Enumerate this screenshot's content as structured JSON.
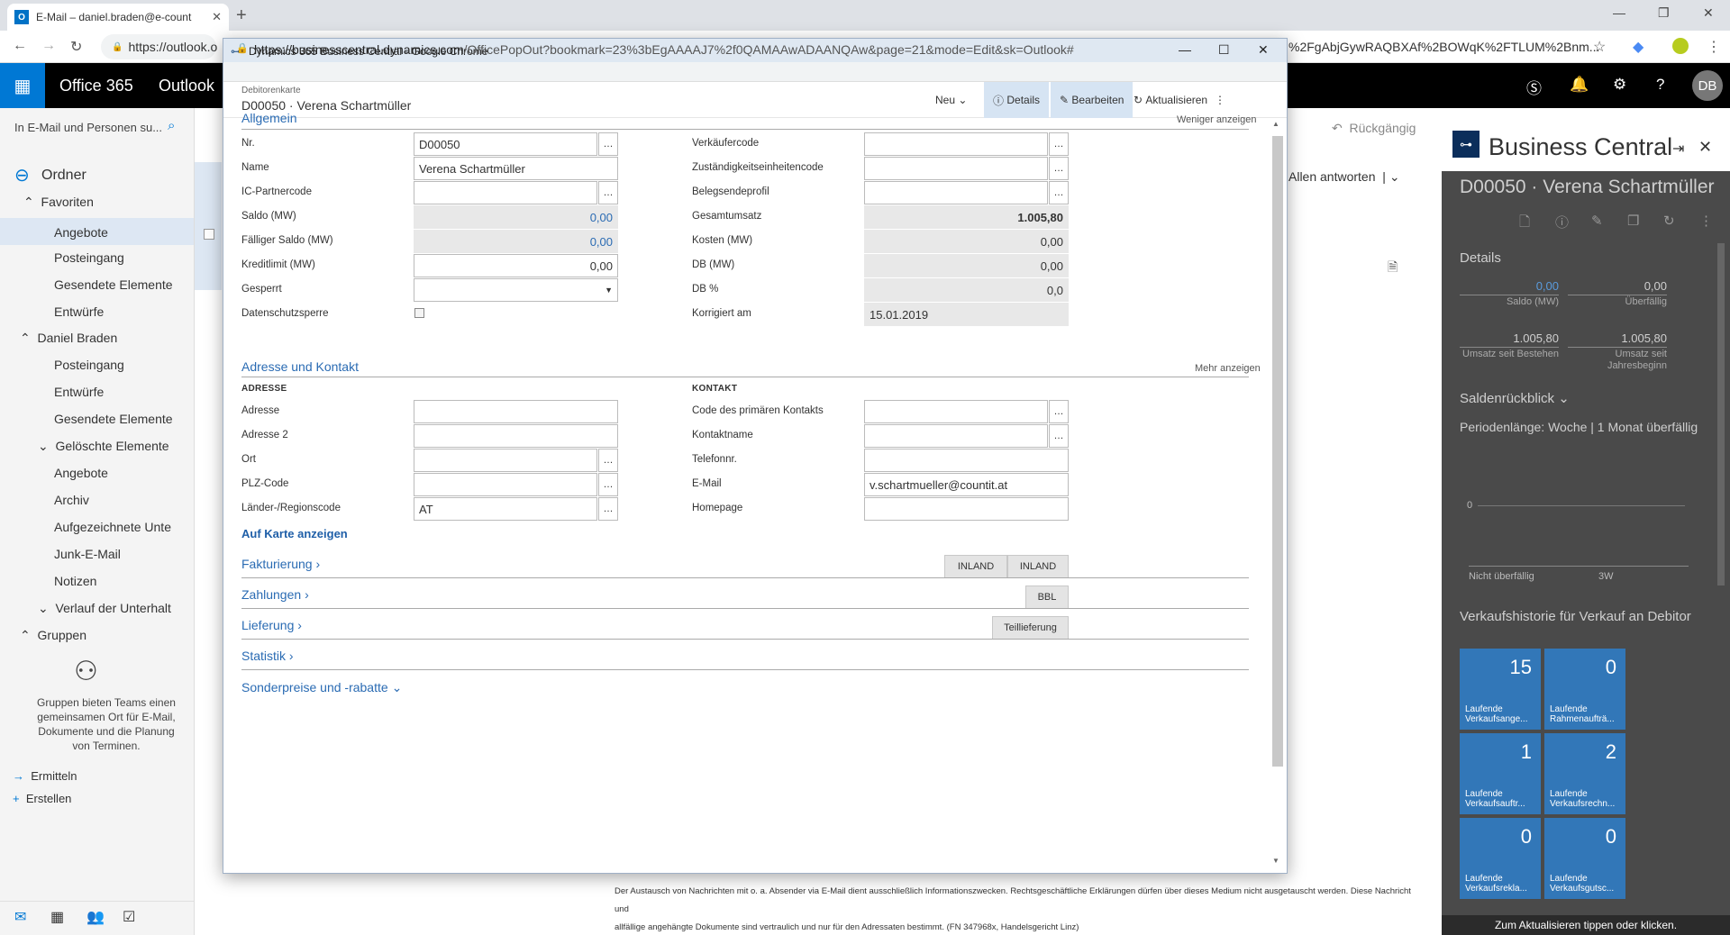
{
  "browser": {
    "tab_title": "E-Mail – daniel.braden@e-count",
    "omnibox": "https://outlook.o",
    "omnibox_tail": "%2FgAbjGywRAQBXAf%2BOWqK%2FTLUM%2Bnm..."
  },
  "suite": {
    "brand": "Office 365",
    "app": "Outlook",
    "avatar": "DB"
  },
  "outlook": {
    "search_placeholder": "In E-Mail und Personen su...",
    "folders_label": "Ordner",
    "favorites": "Favoriten",
    "fav_items": [
      "Angebote",
      "Posteingang",
      "Gesendete Elemente",
      "Entwürfe"
    ],
    "account": "Daniel Braden",
    "acc_items": [
      "Posteingang",
      "Entwürfe",
      "Gesendete Elemente",
      "Gelöschte Elemente",
      "Angebote",
      "Archiv",
      "Aufgezeichnete Unte",
      "Junk-E-Mail",
      "Notizen",
      "Verlauf der Unterhalt"
    ],
    "groups": "Gruppen",
    "groups_desc": "Gruppen bieten Teams einen gemeinsamen Ort für E-Mail, Dokumente und die Planung von Terminen.",
    "discover": "Ermitteln",
    "create": "Erstellen",
    "reply_all": "Allen antworten",
    "undo": "Rückgängig",
    "disclaimer1": "Der Austausch von Nachrichten mit o. a. Absender via E-Mail dient ausschließlich Informationszwecken. Rechtsgeschäftliche Erklärungen dürfen über dieses Medium nicht ausgetauscht werden. Diese Nachricht und",
    "disclaimer2": "allfällige angehängte Dokumente sind vertraulich und nur für den Adressaten bestimmt. (FN 347968x, Handelsgericht Linz)"
  },
  "bcpane": {
    "title": "Business Central",
    "subtitle": "D00050 · Verena Schartmüller",
    "details": "Details",
    "kpis": [
      {
        "value": "0,00",
        "label": "Saldo (MW)"
      },
      {
        "value": "0,00",
        "label": "Überfällig"
      },
      {
        "value": "1.005,80",
        "label": "Umsatz seit Bestehen"
      },
      {
        "value": "1.005,80",
        "label": "Umsatz seit Jahresbeginn"
      }
    ],
    "saldo_title": "Saldenrückblick",
    "period": "Periodenlänge: Woche | 1 Monat überfällig",
    "chart_zero": "0",
    "chart_x1": "Nicht überfällig",
    "chart_x2": "3W",
    "history_title": "Verkaufshistorie für Verkauf an Debitor",
    "tiles": [
      {
        "value": "15",
        "label": "Laufende Verkaufsange..."
      },
      {
        "value": "0",
        "label": "Laufende Rahmenaufträ..."
      },
      {
        "value": "1",
        "label": "Laufende Verkaufsauftr..."
      },
      {
        "value": "2",
        "label": "Laufende Verkaufsrechn..."
      },
      {
        "value": "0",
        "label": "Laufende Verkaufsrekla..."
      },
      {
        "value": "0",
        "label": "Laufende Verkaufsgutsc..."
      }
    ],
    "status": "Zum Aktualisieren tippen oder klicken."
  },
  "popup": {
    "window_title": "Dynamics 365 Business Central - Google Chrome",
    "url_host": "https://businesscentral.dynamics.com",
    "url_path": "/OfficePopOut?bookmark=23%3bEgAAAAJ7%2f0QAMAAwADAANQAw&page=21&mode=Edit&sk=Outlook#",
    "card_type": "Debitorenkarte",
    "card_title": "D00050 · Verena Schartmüller",
    "actions": {
      "new": "Neu",
      "details": "Details",
      "edit": "Bearbeiten",
      "refresh": "Aktualisieren"
    },
    "general": {
      "title": "Allgemein",
      "toggle": "Weniger anzeigen",
      "left": [
        {
          "label": "Nr.",
          "value": "D00050"
        },
        {
          "label": "Name",
          "value": "Verena Schartmüller"
        },
        {
          "label": "IC-Partnercode",
          "value": ""
        },
        {
          "label": "Saldo (MW)",
          "value": "0,00"
        },
        {
          "label": "Fälliger Saldo (MW)",
          "value": "0,00"
        },
        {
          "label": "Kreditlimit (MW)",
          "value": "0,00"
        },
        {
          "label": "Gesperrt",
          "value": ""
        },
        {
          "label": "Datenschutzsperre",
          "value": ""
        }
      ],
      "right": [
        {
          "label": "Verkäufercode",
          "value": ""
        },
        {
          "label": "Zuständigkeitseinheitencode",
          "value": ""
        },
        {
          "label": "Belegsendeprofil",
          "value": ""
        },
        {
          "label": "Gesamtumsatz",
          "value": "1.005,80"
        },
        {
          "label": "Kosten (MW)",
          "value": "0,00"
        },
        {
          "label": "DB (MW)",
          "value": "0,00"
        },
        {
          "label": "DB %",
          "value": "0,0"
        },
        {
          "label": "Korrigiert am",
          "value": "15.01.2019"
        }
      ]
    },
    "address": {
      "title": "Adresse und Kontakt",
      "toggle": "Mehr anzeigen",
      "group_left": "ADRESSE",
      "group_right": "KONTAKT",
      "left": [
        {
          "label": "Adresse",
          "value": ""
        },
        {
          "label": "Adresse 2",
          "value": ""
        },
        {
          "label": "Ort",
          "value": ""
        },
        {
          "label": "PLZ-Code",
          "value": ""
        },
        {
          "label": "Länder-/Regionscode",
          "value": "AT"
        }
      ],
      "right": [
        {
          "label": "Code des primären Kontakts",
          "value": ""
        },
        {
          "label": "Kontaktname",
          "value": ""
        },
        {
          "label": "Telefonnr.",
          "value": ""
        },
        {
          "label": "E-Mail",
          "value": "v.schartmueller@countit.at"
        },
        {
          "label": "Homepage",
          "value": ""
        }
      ],
      "map_link": "Auf Karte anzeigen"
    },
    "sections": [
      {
        "title": "Fakturierung",
        "badges": [
          "INLAND",
          "INLAND"
        ]
      },
      {
        "title": "Zahlungen",
        "badges": [
          "BBL"
        ]
      },
      {
        "title": "Lieferung",
        "badges": [
          "Teillieferung"
        ]
      },
      {
        "title": "Statistik",
        "badges": []
      },
      {
        "title": "Sonderpreise und -rabatte",
        "badges": []
      }
    ]
  }
}
